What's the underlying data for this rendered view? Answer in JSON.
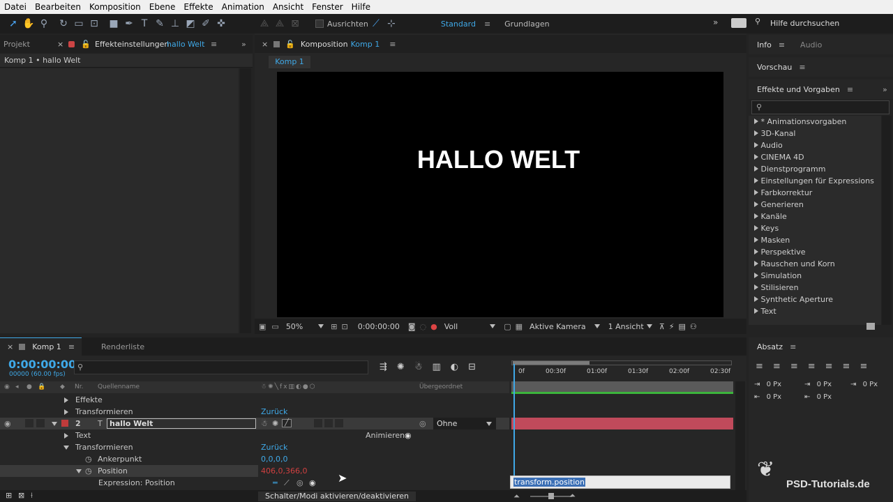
{
  "menu": [
    "Datei",
    "Bearbeiten",
    "Komposition",
    "Ebene",
    "Effekte",
    "Animation",
    "Ansicht",
    "Fenster",
    "Hilfe"
  ],
  "toolbar": {
    "align_label": "Ausrichten",
    "workspace_active": "Standard",
    "workspace_other": "Grundlagen",
    "help_search": "Hilfe durchsuchen"
  },
  "left_panel": {
    "tab_project": "Projekt",
    "tab_effects": "Effekteinstellungen",
    "tab_effects_target": "hallo Welt",
    "breadcrumb": "Komp 1 • hallo Welt"
  },
  "comp_panel": {
    "tab_label": "Komposition",
    "tab_target": "Komp 1",
    "sub_tab": "Komp 1",
    "canvas_text": "HALLO WELT",
    "zoom": "50%",
    "timecode": "0:00:00:00",
    "resolution": "Voll",
    "camera": "Aktive Kamera",
    "views": "1 Ansicht"
  },
  "right_panel": {
    "tab_info": "Info",
    "tab_audio": "Audio",
    "preview": "Vorschau",
    "effects_title": "Effekte und Vorgaben",
    "effects_items": [
      "* Animationsvorgaben",
      "3D-Kanal",
      "Audio",
      "CINEMA 4D",
      "Dienstprogramm",
      "Einstellungen für Expressions",
      "Farbkorrektur",
      "Generieren",
      "Kanäle",
      "Keys",
      "Masken",
      "Perspektive",
      "Rauschen und Korn",
      "Simulation",
      "Stilisieren",
      "Synthetic Aperture",
      "Text"
    ],
    "paragraph_title": "Absatz",
    "paragraph_values": [
      "0 Px",
      "0 Px",
      "0 Px",
      "0 Px",
      "0 Px"
    ]
  },
  "timeline": {
    "tab_comp": "Komp 1",
    "tab_render": "Renderliste",
    "timecode": "0:00:00:00",
    "frame_info": "00000 (60.00 fps)",
    "col_nr": "Nr.",
    "col_source": "Quellenname",
    "col_parent": "Übergeordnet",
    "ruler_labels": [
      "0f",
      "00:30f",
      "01:00f",
      "01:30f",
      "02:00f",
      "02:30f"
    ],
    "rows": {
      "effekte": "Effekte",
      "transform1": "Transformieren",
      "reset1": "Zurück",
      "layer_nr": "2",
      "layer_name": "hallo Welt",
      "parent": "Ohne",
      "text": "Text",
      "animate": "Animieren:",
      "transform2": "Transformieren",
      "reset2": "Zurück",
      "anchor": "Ankerpunkt",
      "anchor_val": "0,0,0,0",
      "position": "Position",
      "position_val": "406,0,366,0",
      "expression": "Expression: Position",
      "expression_code": "transform.position"
    },
    "bottom_toggle": "Schalter/Modi aktivieren/deaktivieren"
  },
  "watermark": "PSD-Tutorials.de"
}
